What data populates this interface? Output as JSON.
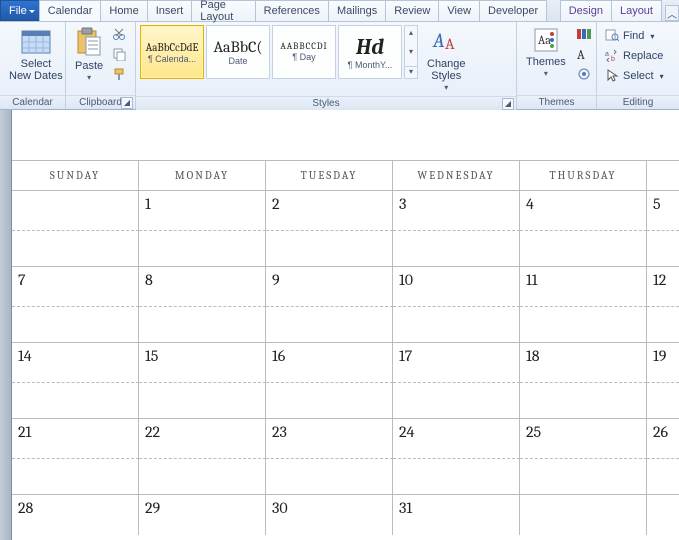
{
  "tabs": {
    "file": "File",
    "items": [
      "Calendar",
      "Home",
      "Insert",
      "Page Layout",
      "References",
      "Mailings",
      "Review",
      "View",
      "Developer"
    ],
    "tool_tabs": [
      "Design",
      "Layout"
    ],
    "active": "Calendar"
  },
  "ribbon": {
    "calendar_group": {
      "select_new_dates": "Select\nNew Dates",
      "label": "Calendar"
    },
    "clipboard_group": {
      "paste": "Paste",
      "label": "Clipboard"
    },
    "styles_group": {
      "items": [
        {
          "sample": "AaBbCcDdE",
          "caption": "¶ Calenda...",
          "selected": true
        },
        {
          "sample": "AaBbC(",
          "caption": "Date",
          "selected": false
        },
        {
          "sample": "AABBCCDI",
          "caption": "¶ Day",
          "selected": false
        },
        {
          "sample": "Hd",
          "caption": "¶ MonthY...",
          "selected": false
        }
      ],
      "change_styles": "Change\nStyles",
      "label": "Styles"
    },
    "themes_group": {
      "themes": "Themes",
      "label": "Themes"
    },
    "editing_group": {
      "find": "Find",
      "replace": "Replace",
      "select": "Select",
      "label": "Editing"
    }
  },
  "calendar": {
    "headers": [
      "SUNDAY",
      "MONDAY",
      "TUESDAY",
      "WEDNESDAY",
      "THURSDAY",
      ""
    ],
    "rows": [
      [
        "",
        "1",
        "2",
        "3",
        "4",
        "5"
      ],
      [
        "7",
        "8",
        "9",
        "10",
        "11",
        "12"
      ],
      [
        "14",
        "15",
        "16",
        "17",
        "18",
        "19"
      ],
      [
        "21",
        "22",
        "23",
        "24",
        "25",
        "26"
      ],
      [
        "28",
        "29",
        "30",
        "31",
        "",
        ""
      ]
    ]
  }
}
